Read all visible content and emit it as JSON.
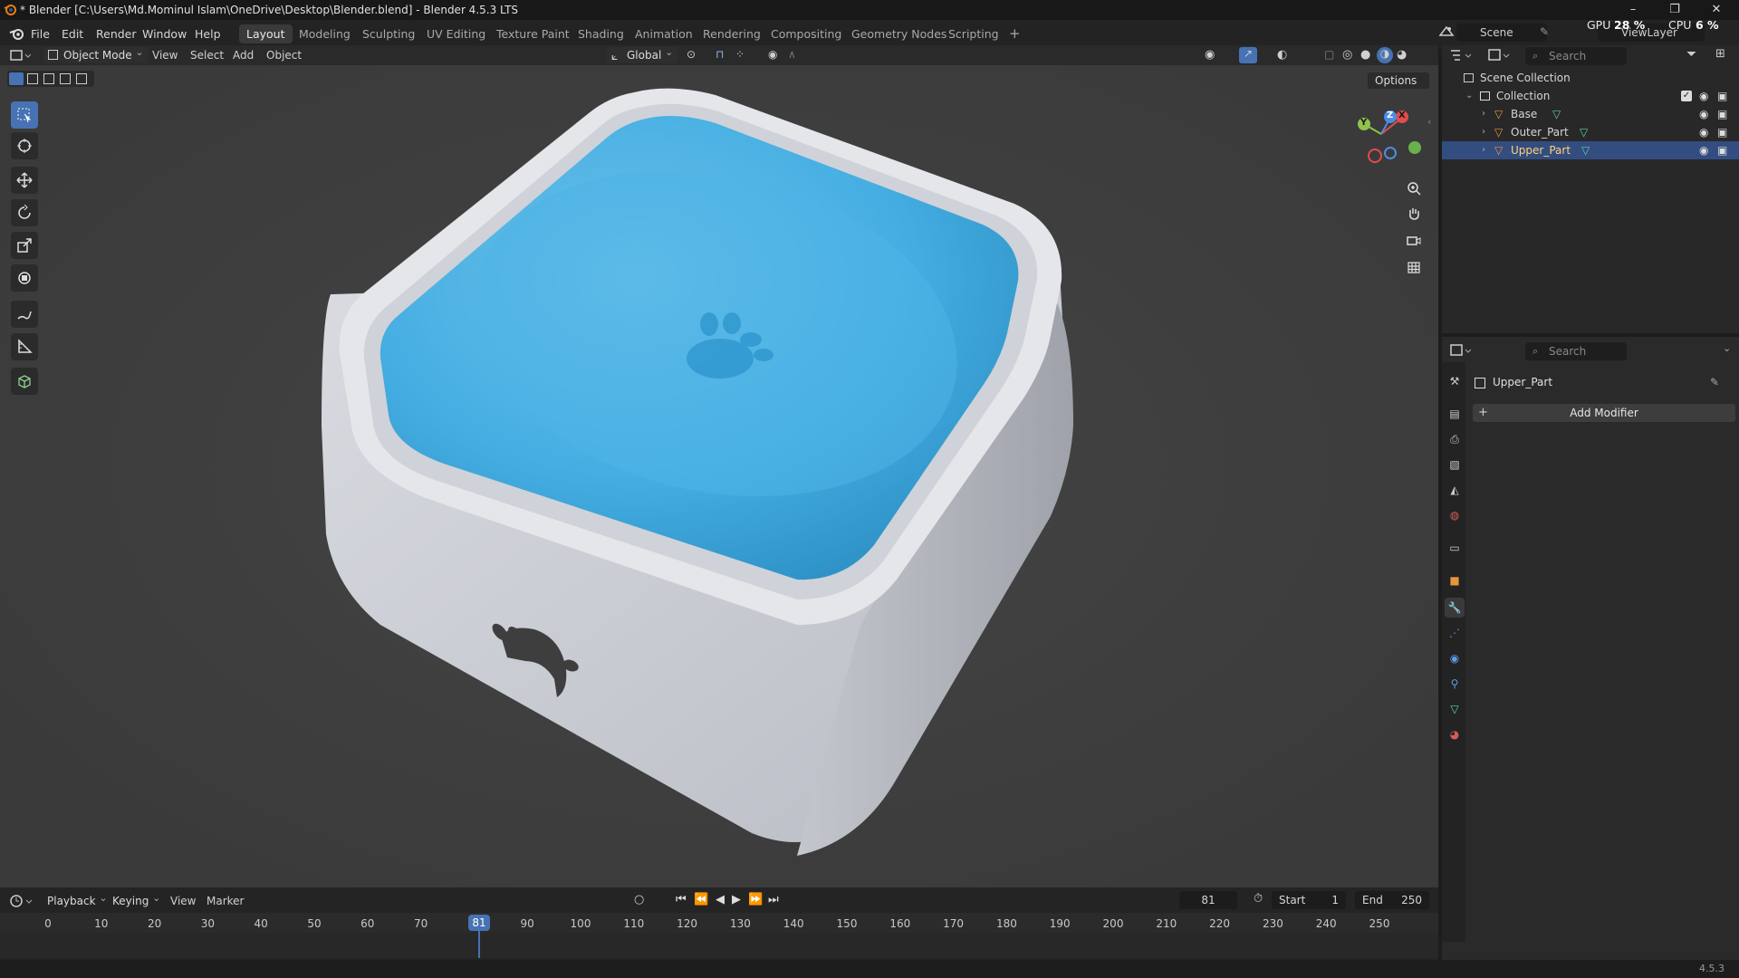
{
  "titlebar": {
    "title": "* Blender [C:\\Users\\Md.Mominul Islam\\OneDrive\\Desktop\\Blender.blend] - Blender 4.5.3 LTS",
    "minimize": "–",
    "maximize": "❐",
    "close": "✕"
  },
  "menu": {
    "items": [
      "File",
      "Edit",
      "Render",
      "Window",
      "Help"
    ]
  },
  "workspaces": {
    "tabs": [
      "Layout",
      "Modeling",
      "Sculpting",
      "UV Editing",
      "Texture Paint",
      "Shading",
      "Animation",
      "Rendering",
      "Compositing",
      "Geometry Nodes",
      "Scripting"
    ],
    "active": "Layout",
    "add": "+"
  },
  "top_right": {
    "scene": "Scene",
    "view_layer": "ViewLayer",
    "gpu_label": "GPU",
    "gpu_value": "28 %",
    "cpu_label": "CPU",
    "cpu_value": "6 %"
  },
  "viewport_header": {
    "mode": "Object Mode",
    "view": "View",
    "select": "Select",
    "add": "Add",
    "object": "Object",
    "orientation": "Global",
    "options": "Options"
  },
  "gizmo": {
    "x": "X",
    "y": "Y",
    "z": "Z"
  },
  "outliner": {
    "search_placeholder": "Search",
    "scene_collection": "Scene Collection",
    "collection": "Collection",
    "objects": [
      "Base",
      "Outer_Part",
      "Upper_Part"
    ],
    "selected": "Upper_Part"
  },
  "properties": {
    "search_placeholder": "Search",
    "object_name": "Upper_Part",
    "add_modifier": "Add Modifier"
  },
  "timeline": {
    "playback": "Playback",
    "keying": "Keying",
    "view": "View",
    "marker": "Marker",
    "current_frame": "81",
    "start_label": "Start",
    "start_value": "1",
    "end_label": "End",
    "end_value": "250",
    "ticks": [
      "0",
      "10",
      "20",
      "30",
      "40",
      "50",
      "60",
      "70",
      "80",
      "90",
      "100",
      "110",
      "120",
      "130",
      "140",
      "150",
      "160",
      "170",
      "180",
      "190",
      "200",
      "210",
      "220",
      "230",
      "240",
      "250"
    ]
  },
  "status": {
    "version": "4.5.3"
  },
  "colors": {
    "accent": "#4772b3",
    "water": "#3aa7dd",
    "bowl": "#c9ccd3",
    "viewport_bg": "#3d3d3d"
  }
}
